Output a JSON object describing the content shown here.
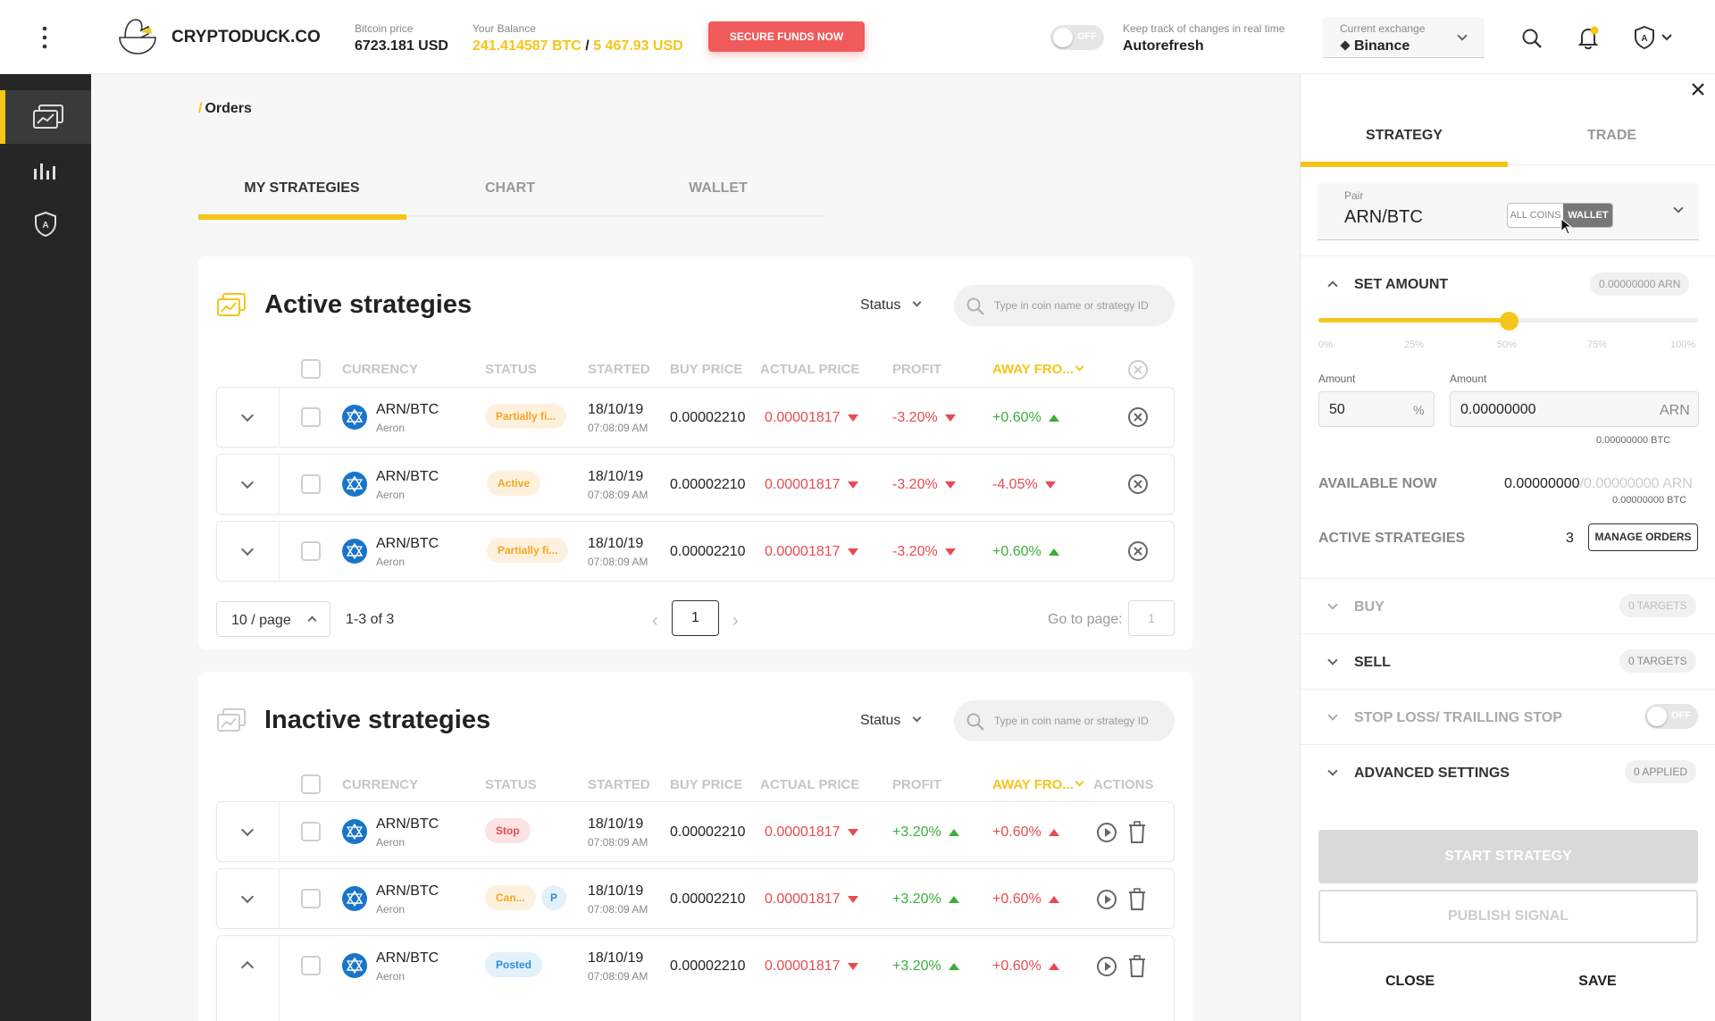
{
  "header": {
    "brand": "CRYPTODUCK.CO",
    "bitcoin_label": "Bitcoin price",
    "bitcoin_value": "6723.181 USD",
    "balance_label": "Your Balance",
    "balance_btc": "241.414587 BTC",
    "balance_sep": " / ",
    "balance_usd": "5 467.93 USD",
    "secure_button": "SECURE FUNDS NOW",
    "toggle_state": "OFF",
    "autorefresh_label": "Keep track of changes in real time",
    "autorefresh_value": "Autorefresh",
    "exchange_label": "Current exchange",
    "exchange_value": "Binance",
    "accent_color": "#f5c518"
  },
  "sidebar": {
    "items": [
      {
        "icon": "strategies-icon",
        "active": true
      },
      {
        "icon": "bar-chart-icon",
        "active": false
      },
      {
        "icon": "shield-icon",
        "active": false
      }
    ]
  },
  "breadcrumb": {
    "slash": "/",
    "label": "Orders"
  },
  "tabs": [
    "MY STRATEGIES",
    "CHART",
    "WALLET"
  ],
  "active": {
    "title": "Active strategies",
    "status_filter": "Status",
    "search_placeholder": "Type in coin name or strategy ID",
    "columns": [
      "CURRENCY",
      "STATUS",
      "STARTED",
      "BUY PRICE",
      "ACTUAL PRICE",
      "PROFIT",
      "AWAY FRO..."
    ],
    "rows": [
      {
        "pair": "ARN/BTC",
        "coin": "Aeron",
        "status": "Partially fi...",
        "date": "18/10/19",
        "time": "07:08:09 AM",
        "buy": "0.00002210",
        "actual": "0.00001817",
        "profit": "-3.20%",
        "away": "+0.60%"
      },
      {
        "pair": "ARN/BTC",
        "coin": "Aeron",
        "status": "Active",
        "date": "18/10/19",
        "time": "07:08:09 AM",
        "buy": "0.00002210",
        "actual": "0.00001817",
        "profit": "-3.20%",
        "away": "-4.05%"
      },
      {
        "pair": "ARN/BTC",
        "coin": "Aeron",
        "status": "Partially fi...",
        "date": "18/10/19",
        "time": "07:08:09 AM",
        "buy": "0.00002210",
        "actual": "0.00001817",
        "profit": "-3.20%",
        "away": "+0.60%"
      }
    ],
    "page_size": "10 / page",
    "range": "1-3 of 3",
    "page": "1",
    "goto_label": "Go to page:",
    "goto_value": "1"
  },
  "inactive": {
    "title": "Inactive strategies",
    "status_filter": "Status",
    "search_placeholder": "Type in coin name or strategy ID",
    "columns": [
      "CURRENCY",
      "STATUS",
      "STARTED",
      "BUY PRICE",
      "ACTUAL PRICE",
      "PROFIT",
      "AWAY FRO...",
      "ACTIONS"
    ],
    "rows": [
      {
        "pair": "ARN/BTC",
        "coin": "Aeron",
        "status": "Stop",
        "date": "18/10/19",
        "time": "07:08:09 AM",
        "buy": "0.00002210",
        "actual": "0.00001817",
        "profit": "+3.20%",
        "away": "+0.60%"
      },
      {
        "pair": "ARN/BTC",
        "coin": "Aeron",
        "status": "Can...",
        "extra": "P",
        "date": "18/10/19",
        "time": "07:08:09 AM",
        "buy": "0.00002210",
        "actual": "0.00001817",
        "profit": "+3.20%",
        "away": "+0.60%"
      },
      {
        "pair": "ARN/BTC",
        "coin": "Aeron",
        "status": "Posted",
        "date": "18/10/19",
        "time": "07:08:09 AM",
        "buy": "0.00002210",
        "actual": "0.00001817",
        "profit": "+3.20%",
        "away": "+0.60%"
      }
    ]
  },
  "panel": {
    "tabs": [
      "STRATEGY",
      "TRADE"
    ],
    "pair_label": "Pair",
    "pair_value": "ARN/BTC",
    "seg_all": "ALL COINS",
    "seg_wallet": "WALLET",
    "set_amount": "SET AMOUNT",
    "set_amount_badge": "0.00000000 ARN",
    "slider_ticks": [
      "0%",
      "25%",
      "50%",
      "75%",
      "100%"
    ],
    "slider_value": 50,
    "amount_label": "Amount",
    "amount_pct_value": "50",
    "amount_pct_unit": "%",
    "amount_arn_label": "Amount",
    "amount_arn_value": "0.00000000",
    "amount_arn_unit": "ARN",
    "amount_btc": "0.00000000 BTC",
    "available_label": "AVAILABLE NOW",
    "available_value": "0.00000000",
    "available_total": "/0.00000000 ARN",
    "available_btc": "0.00000000 BTC",
    "active_label": "ACTIVE STRATEGIES",
    "active_count": "3",
    "manage_button": "MANAGE ORDERS",
    "buy_label": "BUY",
    "buy_badge": "0 TARGETS",
    "sell_label": "SELL",
    "sell_badge": "0 TARGETS",
    "stoploss_label": "STOP LOSS/ TRAILLING STOP",
    "stoploss_toggle": "OFF",
    "advanced_label": "ADVANCED SETTINGS",
    "advanced_badge": "0 APPLIED",
    "start_button": "START STRATEGY",
    "publish_button": "PUBLISH SIGNAL",
    "close_button": "CLOSE",
    "save_button": "SAVE"
  }
}
